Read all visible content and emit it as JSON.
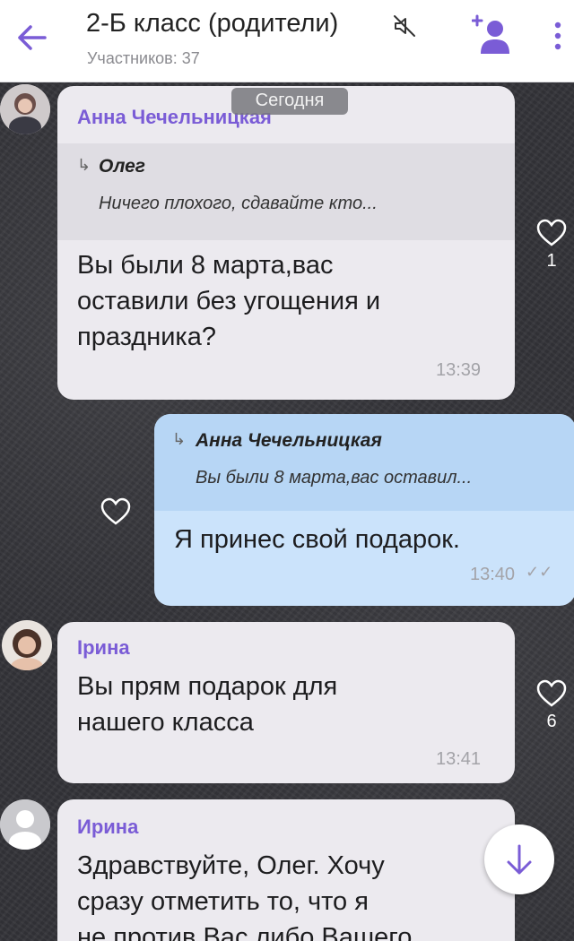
{
  "header": {
    "title": "2-Б класс (родители)",
    "participants": "Участников: 37",
    "colors": {
      "accent": "#7a5cd6"
    },
    "icons": [
      "arrow-left-icon",
      "mute-icon",
      "add-member-icon",
      "more-vert-icon"
    ]
  },
  "date_badge": "Сегодня",
  "messages": [
    {
      "sender": "Анна Чечельницкая",
      "quote": {
        "name": "Олег",
        "text": "Ничего плохого, сдавайте кто..."
      },
      "lines": [
        "Вы были 8 марта,вас",
        "оставили без угощения и",
        "праздника?"
      ],
      "time": "13:39",
      "likes": "1"
    },
    {
      "outgoing": true,
      "quote": {
        "name": "Анна Чечельницкая",
        "text": "Вы были 8 марта,вас оставил..."
      },
      "lines": [
        "Я принес свой подарок."
      ],
      "time": "13:40"
    },
    {
      "sender": "Ірина",
      "lines": [
        "Вы прям подарок для",
        "нашего класса"
      ],
      "time": "13:41",
      "likes": "6"
    },
    {
      "sender": "Ирина",
      "lines": [
        "Здравствуйте, Олег.  Хочу",
        "сразу отметить то,  что я",
        "не против Вас либо Вашего"
      ]
    }
  ]
}
